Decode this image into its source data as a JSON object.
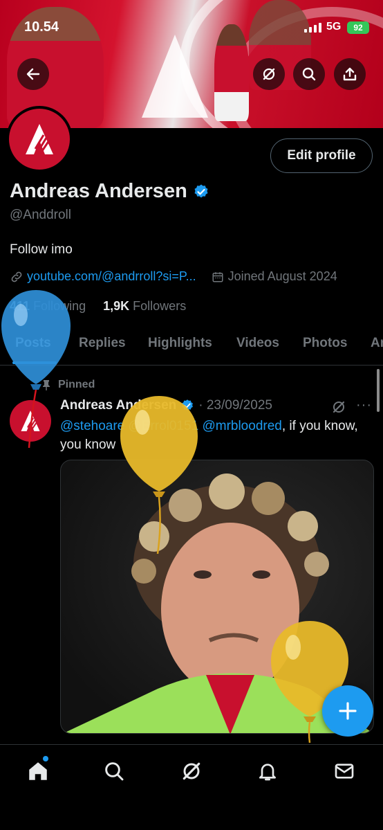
{
  "status_bar": {
    "time": "10.54",
    "network": "5G",
    "battery": "92"
  },
  "profile": {
    "name": "Andreas Andersen",
    "handle": "@Anddroll",
    "bio": "Follow imo",
    "link": "youtube.com/@andrroll?si=P...",
    "joined": "Joined August 2024",
    "following_count": "411",
    "following_label": "Following",
    "followers_count": "1,9K",
    "followers_label": "Followers",
    "edit_button": "Edit profile"
  },
  "tabs": [
    "Posts",
    "Replies",
    "Highlights",
    "Videos",
    "Photos",
    "Ar"
  ],
  "pinned_post": {
    "pinned_label": "Pinned",
    "author": "Andreas Andersen",
    "date": "· 23/09/2025",
    "mentions": "@stehoare @Errol0151 @mrbloodred",
    "text": ", if you know, you know",
    "more": "···"
  },
  "colors": {
    "accent": "#1d9bf0",
    "background": "#000000",
    "muted": "#71767b",
    "brand_red": "#c8102e"
  },
  "icons": {
    "back": "arrow-left-icon",
    "grok": "grok-icon",
    "search": "search-icon",
    "share": "share-icon",
    "verified": "verified-badge-icon",
    "link": "link-icon",
    "calendar": "calendar-icon",
    "pin": "pin-icon",
    "compose": "plus-icon",
    "home": "home-icon",
    "explore": "search-icon",
    "notifications": "bell-icon",
    "messages": "mail-icon"
  }
}
